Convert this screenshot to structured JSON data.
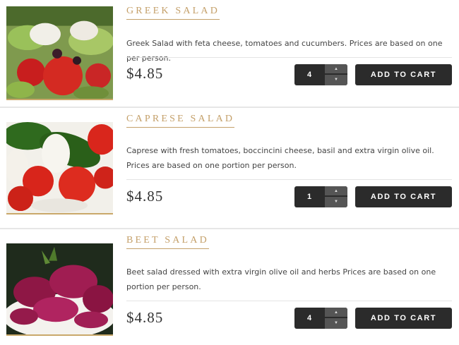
{
  "products": [
    {
      "name": "GREEK SALAD",
      "image": "greek-salad-photo",
      "description": "Greek Salad with feta cheese, tomatoes and cucumbers. Prices are based on one per person.",
      "price": "$4.85",
      "quantity": "4",
      "cart_label": "ADD TO CART"
    },
    {
      "name": "CAPRESE SALAD",
      "image": "caprese-salad-photo",
      "description": "Caprese with fresh tomatoes, boccincini cheese, basil and extra virgin olive oil. Prices are based on one portion per person.",
      "price": "$4.85",
      "quantity": "1",
      "cart_label": "ADD TO CART"
    },
    {
      "name": "BEET SALAD",
      "image": "beet-salad-photo",
      "description": "Beet salad dressed with extra virgin olive oil and herbs Prices are based on one portion per person.",
      "price": "$4.85",
      "quantity": "4",
      "cart_label": "ADD TO CART"
    }
  ],
  "colors": {
    "accent": "#c4a06a",
    "button": "#2b2b2b",
    "stepper": "#555555"
  },
  "icons": {
    "up": "caret-up-icon",
    "down": "caret-down-icon"
  }
}
